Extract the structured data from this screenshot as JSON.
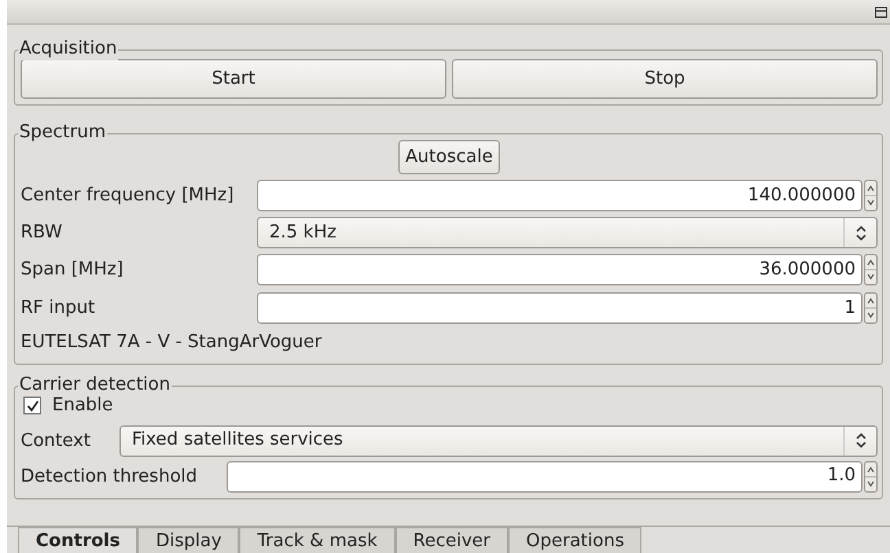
{
  "acquisition": {
    "title": "Acquisition",
    "buttons": [
      "Start",
      "Stop"
    ]
  },
  "spectrum": {
    "title": "Spectrum",
    "autoscale": "Autoscale",
    "fields": [
      {
        "kind": "spin",
        "label": "Center frequency [MHz]",
        "value": "140.000000"
      },
      {
        "kind": "combo",
        "label": "RBW",
        "value": "2.5 kHz"
      },
      {
        "kind": "spin",
        "label": "Span [MHz]",
        "value": "36.000000"
      },
      {
        "kind": "spin",
        "label": "RF input",
        "value": "1"
      }
    ],
    "info": "EUTELSAT 7A - V - StangArVoguer"
  },
  "carrier_detection": {
    "title": "Carrier detection",
    "enable": {
      "label": "Enable",
      "checked": true
    },
    "fields": [
      {
        "kind": "combo",
        "label": "Context",
        "value": "Fixed satellites services"
      },
      {
        "kind": "spin",
        "label": "Detection threshold",
        "value": "1.0"
      }
    ]
  },
  "tabs": [
    {
      "label": "Controls",
      "selected": true
    },
    {
      "label": "Display",
      "selected": false
    },
    {
      "label": "Track & mask",
      "selected": false
    },
    {
      "label": "Receiver",
      "selected": false
    },
    {
      "label": "Operations",
      "selected": false
    }
  ]
}
